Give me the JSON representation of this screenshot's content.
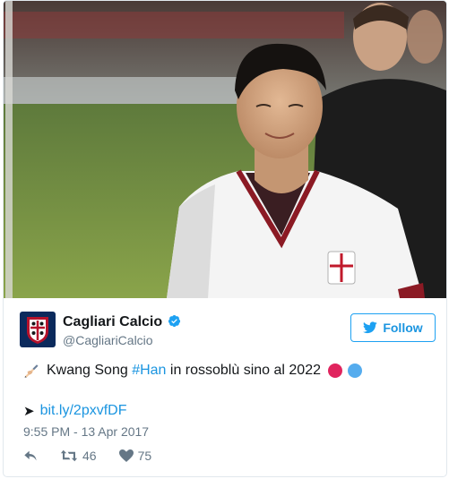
{
  "tweet": {
    "author_name": "Cagliari Calcio",
    "handle": "@CagliariCalcio",
    "follow_label": "Follow",
    "text_before_hashtag": "Kwang Song ",
    "hashtag": "#Han",
    "text_after_hashtag": " in rossoblù sino al 2022",
    "link_text": "bit.ly/2pxvfDF",
    "timestamp": "9:55 PM - 13 Apr 2017",
    "retweet_count": "46",
    "like_count": "75",
    "avatar_text": "CAGLIARI"
  },
  "colors": {
    "accent": "#1da1f2",
    "link": "#1b95e0",
    "red_dot": "#e0245e",
    "blue_dot": "#55acee"
  },
  "icons": {
    "verified": "verified-badge-icon",
    "follow": "twitter-bird-icon",
    "writing": "writing-hand-icon",
    "arrow": "right-arrowhead-icon",
    "reply": "reply-icon",
    "retweet": "retweet-icon",
    "like": "heart-icon"
  }
}
